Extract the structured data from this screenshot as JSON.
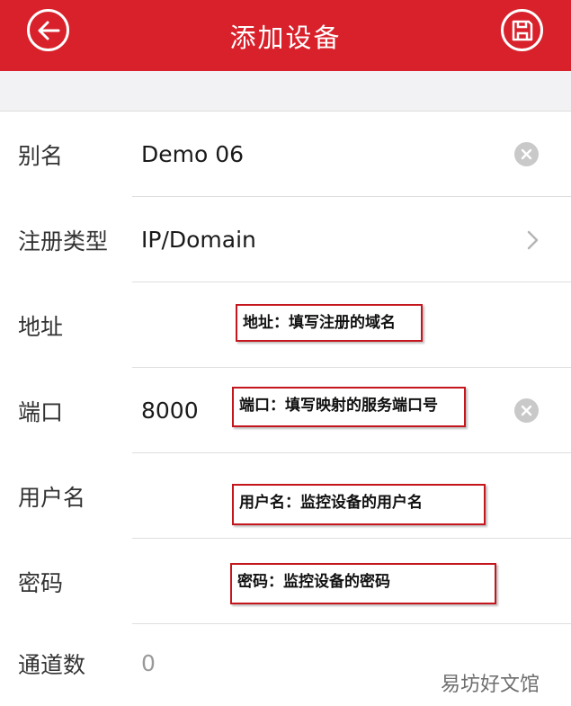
{
  "header": {
    "title": "添加设备",
    "back_icon": "back-arrow-icon",
    "save_icon": "save-icon",
    "bg_color": "#d8212b"
  },
  "form": {
    "rows": [
      {
        "label": "别名",
        "value": "Demo  06",
        "control": "clear"
      },
      {
        "label": "注册类型",
        "value": "IP/Domain",
        "control": "chevron"
      },
      {
        "label": "地址",
        "value": ""
      },
      {
        "label": "端口",
        "value": "8000",
        "control": "clear"
      },
      {
        "label": "用户名",
        "value": ""
      },
      {
        "label": "密码",
        "value": ""
      },
      {
        "label": "通道数",
        "value": "0"
      }
    ]
  },
  "annotations": [
    "地址：填写注册的域名",
    "端口：填写映射的服务端口号",
    "用户名：监控设备的用户名",
    "密码：监控设备的密码"
  ],
  "watermark": "易坊好文馆"
}
